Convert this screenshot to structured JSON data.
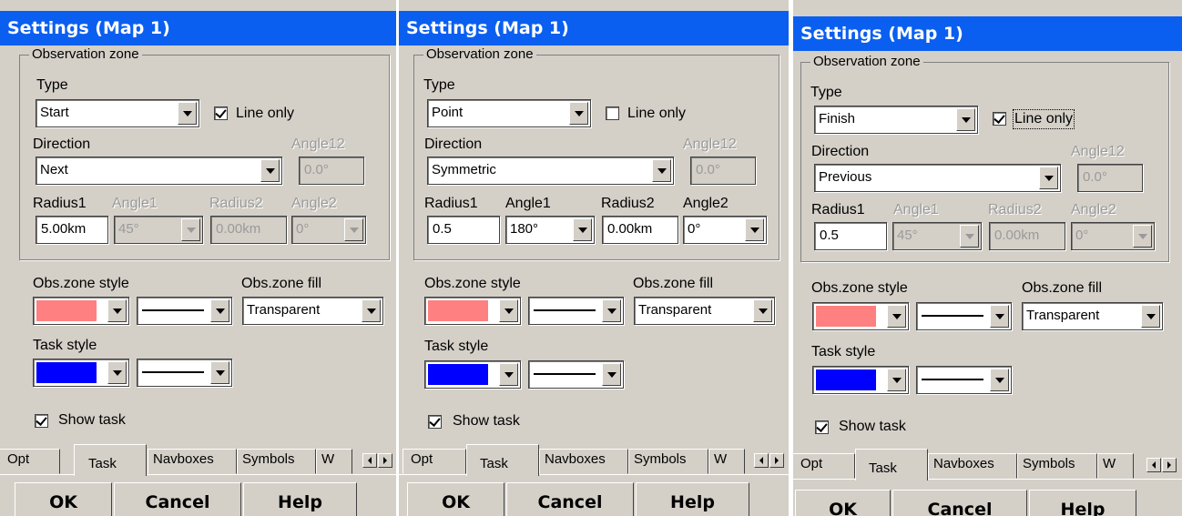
{
  "panels": [
    {
      "title": "Settings (Map 1)",
      "group_title": "Observation zone",
      "type_label": "Type",
      "type_value": "Start",
      "line_only_label": "Line only",
      "line_only_checked": true,
      "direction_label": "Direction",
      "direction_value": "Next",
      "angle12_label": "Angle12",
      "angle12_value": "0.0°",
      "radius1_label": "Radius1",
      "radius1_value": "5.00km",
      "angle1_label": "Angle1",
      "angle1_value": "45°",
      "radius2_label": "Radius2",
      "radius2_value": "0.00km",
      "angle2_label": "Angle2",
      "angle2_value": "0°",
      "obs_zone_style_label": "Obs.zone style",
      "obs_zone_fill_label": "Obs.zone fill",
      "obs_zone_fill_value": "Transparent",
      "task_style_label": "Task style",
      "show_task_label": "Show task",
      "show_task_checked": true,
      "tabs": [
        "Opt",
        "Task",
        "Navboxes",
        "Symbols",
        "W"
      ],
      "ok_label": "OK",
      "cancel_label": "Cancel",
      "help_label": "Help"
    },
    {
      "title": "Settings (Map 1)",
      "group_title": "Observation zone",
      "type_label": "Type",
      "type_value": "Point",
      "line_only_label": "Line only",
      "line_only_checked": false,
      "direction_label": "Direction",
      "direction_value": "Symmetric",
      "angle12_label": "Angle12",
      "angle12_value": "0.0°",
      "radius1_label": "Radius1",
      "radius1_value": "0.5",
      "angle1_label": "Angle1",
      "angle1_value": "180°",
      "radius2_label": "Radius2",
      "radius2_value": "0.00km",
      "angle2_label": "Angle2",
      "angle2_value": "0°",
      "obs_zone_style_label": "Obs.zone style",
      "obs_zone_fill_label": "Obs.zone fill",
      "obs_zone_fill_value": "Transparent",
      "task_style_label": "Task style",
      "show_task_label": "Show task",
      "show_task_checked": true,
      "tabs": [
        "Opt",
        "Task",
        "Navboxes",
        "Symbols",
        "W"
      ],
      "ok_label": "OK",
      "cancel_label": "Cancel",
      "help_label": "Help"
    },
    {
      "title": "Settings (Map 1)",
      "group_title": "Observation zone",
      "type_label": "Type",
      "type_value": "Finish",
      "line_only_label": "Line only",
      "line_only_checked": true,
      "direction_label": "Direction",
      "direction_value": "Previous",
      "angle12_label": "Angle12",
      "angle12_value": "0.0°",
      "radius1_label": "Radius1",
      "radius1_value": "0.5",
      "angle1_label": "Angle1",
      "angle1_value": "45°",
      "radius2_label": "Radius2",
      "radius2_value": "0.00km",
      "angle2_label": "Angle2",
      "angle2_value": "0°",
      "obs_zone_style_label": "Obs.zone style",
      "obs_zone_fill_label": "Obs.zone fill",
      "obs_zone_fill_value": "Transparent",
      "task_style_label": "Task style",
      "show_task_label": "Show task",
      "show_task_checked": true,
      "tabs": [
        "Opt",
        "Task",
        "Navboxes",
        "Symbols",
        "W"
      ],
      "ok_label": "OK",
      "cancel_label": "Cancel",
      "help_label": "Help"
    }
  ],
  "colors": {
    "titlebar": "#0a5ff0",
    "obs_zone_color": "#ff8080",
    "task_color": "#0000ff",
    "dialog_bg": "#d4d0c8"
  }
}
